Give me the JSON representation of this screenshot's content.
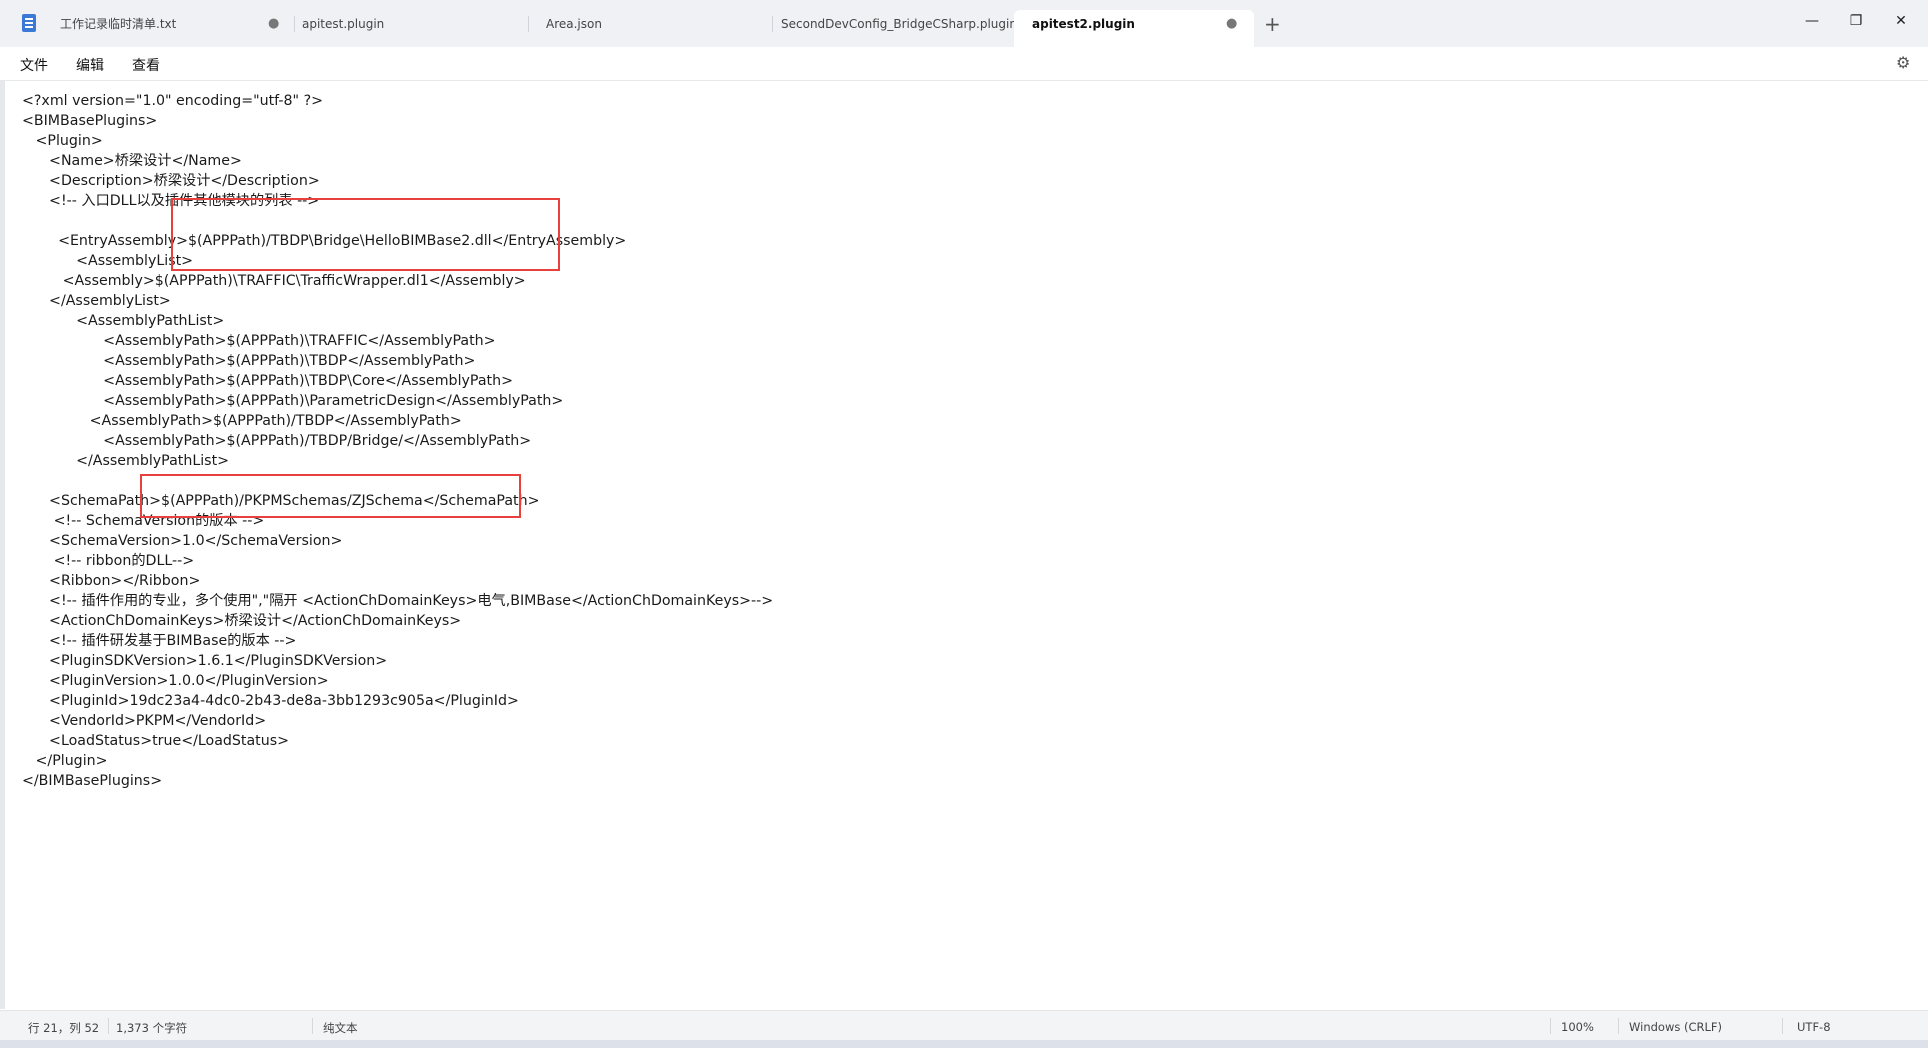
{
  "tabs": [
    {
      "label": "工作记录临时清单.txt",
      "modified": true
    },
    {
      "label": "apitest.plugin",
      "modified": false
    },
    {
      "label": "Area.json",
      "modified": false
    },
    {
      "label": "SecondDevConfig_BridgeCSharp.plugin",
      "modified": false
    },
    {
      "label": "apitest2.plugin",
      "modified": true,
      "active": true
    }
  ],
  "new_tab_label": "+",
  "window_controls": {
    "minimize": "—",
    "maximize": "❐",
    "close": "✕"
  },
  "menu": {
    "file": "文件",
    "edit": "编辑",
    "view": "查看"
  },
  "editor_lines": [
    "<?xml version=\"1.0\" encoding=\"utf-8\" ?>",
    "<BIMBasePlugins>",
    "   <Plugin>",
    "      <Name>桥梁设计</Name>",
    "      <Description>桥梁设计</Description>",
    "      <!-- 入口DLL以及插件其他模块的列表 -->",
    "",
    "        <EntryAssembly>$(APPPath)/TBDP\\Bridge\\HelloBIMBase2.dll</EntryAssembly>",
    "            <AssemblyList>",
    "         <Assembly>$(APPPath)\\TRAFFIC\\TrafficWrapper.dl1</Assembly>",
    "      </AssemblyList>",
    "            <AssemblyPathList>",
    "                  <AssemblyPath>$(APPPath)\\TRAFFIC</AssemblyPath>",
    "                  <AssemblyPath>$(APPPath)\\TBDP</AssemblyPath>",
    "                  <AssemblyPath>$(APPPath)\\TBDP\\Core</AssemblyPath>",
    "                  <AssemblyPath>$(APPPath)\\ParametricDesign</AssemblyPath>",
    "               <AssemblyPath>$(APPPath)/TBDP</AssemblyPath>",
    "                  <AssemblyPath>$(APPPath)/TBDP/Bridge/</AssemblyPath>",
    "            </AssemblyPathList>",
    "",
    "      <SchemaPath>$(APPPath)/PKPMSchemas/ZJSchema</SchemaPath>",
    "       <!-- SchemaVersion的版本 -->",
    "      <SchemaVersion>1.0</SchemaVersion>",
    "       <!-- ribbon的DLL-->",
    "      <Ribbon></Ribbon>",
    "      <!-- 插件作用的专业，多个使用\",\"隔开 <ActionChDomainKeys>电气,BIMBase</ActionChDomainKeys>-->",
    "      <ActionChDomainKeys>桥梁设计</ActionChDomainKeys>",
    "      <!-- 插件研发基于BIMBase的版本 -->",
    "      <PluginSDKVersion>1.6.1</PluginSDKVersion>",
    "      <PluginVersion>1.0.0</PluginVersion>",
    "      <PluginId>19dc23a4-4dc0-2b43-de8a-3bb1293c905a</PluginId>",
    "      <VendorId>PKPM</VendorId>",
    "      <LoadStatus>true</LoadStatus>",
    "   </Plugin>",
    "</BIMBasePlugins>"
  ],
  "status": {
    "position": "行 21，列 52",
    "char_count": "1,373 个字符",
    "format": "纯文本",
    "zoom": "100%",
    "line_ending": "Windows (CRLF)",
    "encoding": "UTF-8"
  },
  "colors": {
    "highlight_box": "#e8403c",
    "tab_bar": "#eff1f5"
  }
}
